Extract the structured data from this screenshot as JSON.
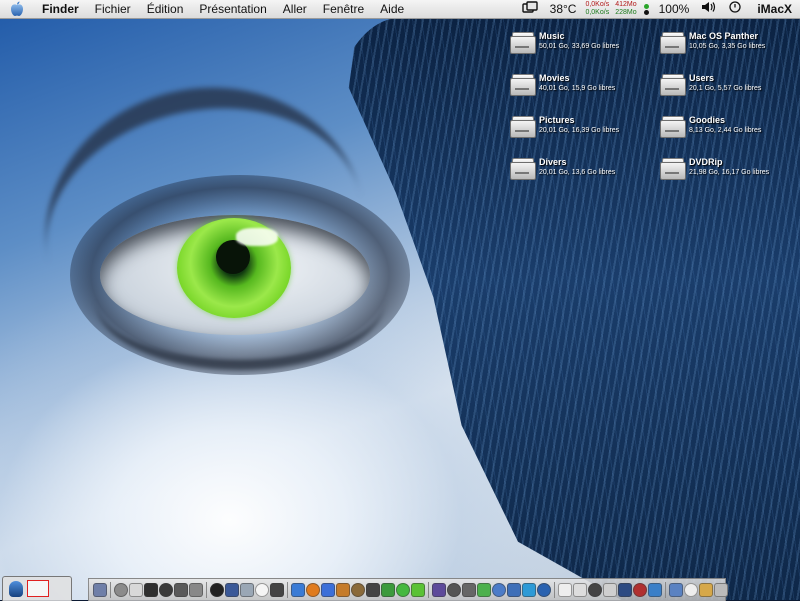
{
  "menubar": {
    "app_name": "Finder",
    "menus": [
      "Fichier",
      "Édition",
      "Présentation",
      "Aller",
      "Fenêtre",
      "Aide"
    ],
    "temperature": "38°C",
    "net_up": "0,0Ko/s",
    "net_down": "0,0Ko/s",
    "mem_top": "412Mo",
    "mem_bottom": "228Mo",
    "battery": "100%",
    "hostname": "iMacX",
    "colors": {
      "net_up": "#b01818",
      "net_down": "#1b7a1b"
    }
  },
  "desktop": {
    "volumes": [
      {
        "name": "Music",
        "info": "50,01 Go, 33,69 Go libres"
      },
      {
        "name": "Movies",
        "info": "40,01 Go, 15,9 Go libres"
      },
      {
        "name": "Pictures",
        "info": "20,01 Go, 16,39 Go libres"
      },
      {
        "name": "Divers",
        "info": "20,01 Go, 13,6 Go libres"
      },
      {
        "name": "Mac OS Panther",
        "info": "10,05 Go, 3,35 Go libres"
      },
      {
        "name": "Users",
        "info": "20,1 Go, 5,57 Go libres"
      },
      {
        "name": "Goodies",
        "info": "8,13 Go, 2,44 Go libres"
      },
      {
        "name": "DVDRip",
        "info": "21,98 Go, 16,17 Go libres"
      }
    ]
  },
  "dock": {
    "icons": [
      {
        "name": "preview-icon",
        "color": "#6f7fa8"
      },
      {
        "name": "address-book-icon",
        "color": "#8b8b8b"
      },
      {
        "name": "ical-icon",
        "color": "#d8d8d8"
      },
      {
        "name": "itunes-icon",
        "color": "#2f2f2f"
      },
      {
        "name": "dvd-player-icon",
        "color": "#3a3a3a"
      },
      {
        "name": "disk-utility-icon",
        "color": "#5a5a5a"
      },
      {
        "name": "system-preferences-icon",
        "color": "#888888"
      },
      {
        "name": "terminal-icon",
        "color": "#222222"
      },
      {
        "name": "console-icon",
        "color": "#3b5998"
      },
      {
        "name": "network-icon",
        "color": "#9aa7b5"
      },
      {
        "name": "x11-icon",
        "color": "#f5f5f5"
      },
      {
        "name": "graphics-app-icon",
        "color": "#444444"
      },
      {
        "name": "safari-icon",
        "color": "#3a7bd5"
      },
      {
        "name": "firefox-icon",
        "color": "#e07b1e"
      },
      {
        "name": "ie-icon",
        "color": "#3c6fd8"
      },
      {
        "name": "folder-icon",
        "color": "#c57b2a"
      },
      {
        "name": "mail-icon",
        "color": "#8a6a3a"
      },
      {
        "name": "camino-icon",
        "color": "#444444"
      },
      {
        "name": "chat-icon",
        "color": "#3c9a3c"
      },
      {
        "name": "skype-icon",
        "color": "#45b83f"
      },
      {
        "name": "messenger-icon",
        "color": "#5bc236"
      },
      {
        "name": "imovie-icon",
        "color": "#5d4a9a"
      },
      {
        "name": "tools-icon",
        "color": "#555555"
      },
      {
        "name": "burn-icon",
        "color": "#666666"
      },
      {
        "name": "limewire-icon",
        "color": "#4cb04c"
      },
      {
        "name": "quicktime-icon",
        "color": "#4c7cc8"
      },
      {
        "name": "media-player-icon",
        "color": "#3e6fb8"
      },
      {
        "name": "vlc-icon",
        "color": "#2d9ad6"
      },
      {
        "name": "stuffit-icon",
        "color": "#2a62b0"
      },
      {
        "name": "network-utility-icon",
        "color": "#eeeeee"
      },
      {
        "name": "cheese-icon",
        "color": "#dddddd"
      },
      {
        "name": "dog-icon",
        "color": "#444444"
      },
      {
        "name": "calculator-icon",
        "color": "#cfcfcf"
      },
      {
        "name": "photoshop-icon",
        "color": "#2c4a82"
      },
      {
        "name": "flash-icon",
        "color": "#b03030"
      },
      {
        "name": "photo-app-icon",
        "color": "#3a7fc8"
      },
      {
        "name": "apps-folder-icon",
        "color": "#5a82c2"
      },
      {
        "name": "home-folder-icon",
        "color": "#eeeeee"
      },
      {
        "name": "documents-folder-icon",
        "color": "#d6a84a"
      },
      {
        "name": "trash-icon",
        "color": "#bbbbbb"
      }
    ]
  }
}
